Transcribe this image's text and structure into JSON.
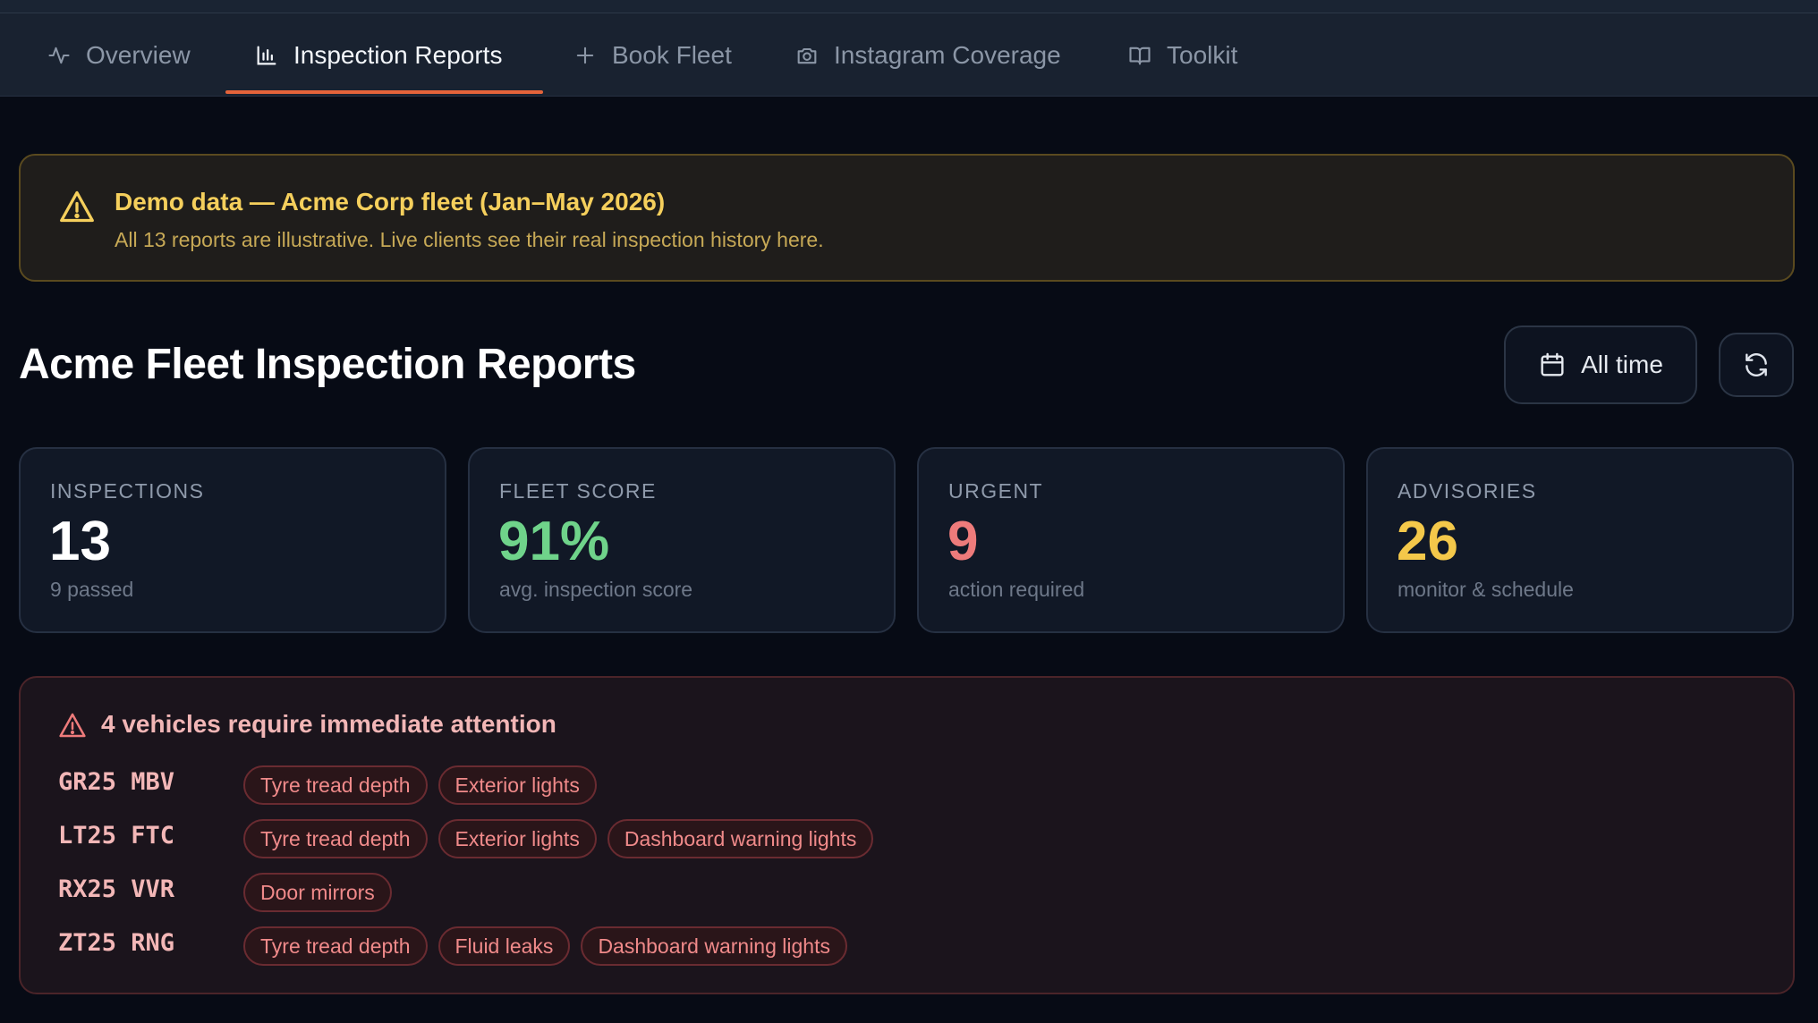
{
  "nav": {
    "tabs": [
      {
        "label": "Overview",
        "icon": "activity-icon",
        "active": false
      },
      {
        "label": "Inspection Reports",
        "icon": "bar-chart-icon",
        "active": true
      },
      {
        "label": "Book Fleet",
        "icon": "plus-icon",
        "active": false
      },
      {
        "label": "Instagram Coverage",
        "icon": "camera-icon",
        "active": false
      },
      {
        "label": "Toolkit",
        "icon": "book-open-icon",
        "active": false
      }
    ]
  },
  "banner": {
    "title": "Demo data — Acme Corp fleet (Jan–May 2026)",
    "subtitle": "All 13 reports are illustrative. Live clients see their real inspection history here.",
    "icon": "warning-triangle-icon"
  },
  "header": {
    "title": "Acme Fleet Inspection Reports",
    "range_label": "All time",
    "range_icon": "calendar-icon",
    "refresh_icon": "refresh-icon"
  },
  "stats": [
    {
      "label": "INSPECTIONS",
      "value": "13",
      "note": "9 passed",
      "color": "#ffffff"
    },
    {
      "label": "FLEET SCORE",
      "value": "91%",
      "note": "avg. inspection score",
      "color": "#6fd38a"
    },
    {
      "label": "URGENT",
      "value": "9",
      "note": "action required",
      "color": "#ee7b7b"
    },
    {
      "label": "ADVISORIES",
      "value": "26",
      "note": "monitor & schedule",
      "color": "#f4c84a"
    }
  ],
  "urgent": {
    "title": "4 vehicles require immediate attention",
    "vehicles": [
      {
        "plate": "GR25 MBV",
        "issues": [
          "Tyre tread depth",
          "Exterior lights"
        ]
      },
      {
        "plate": "LT25 FTC",
        "issues": [
          "Tyre tread depth",
          "Exterior lights",
          "Dashboard warning lights"
        ]
      },
      {
        "plate": "RX25 VVR",
        "issues": [
          "Door mirrors"
        ]
      },
      {
        "plate": "ZT25 RNG",
        "issues": [
          "Tyre tread depth",
          "Fluid leaks",
          "Dashboard warning lights"
        ]
      }
    ]
  },
  "colors": {
    "accent": "#e4633a",
    "warning": "#f5cf5c",
    "success": "#6fd38a",
    "danger": "#ee7b7b",
    "advisory": "#f4c84a"
  }
}
